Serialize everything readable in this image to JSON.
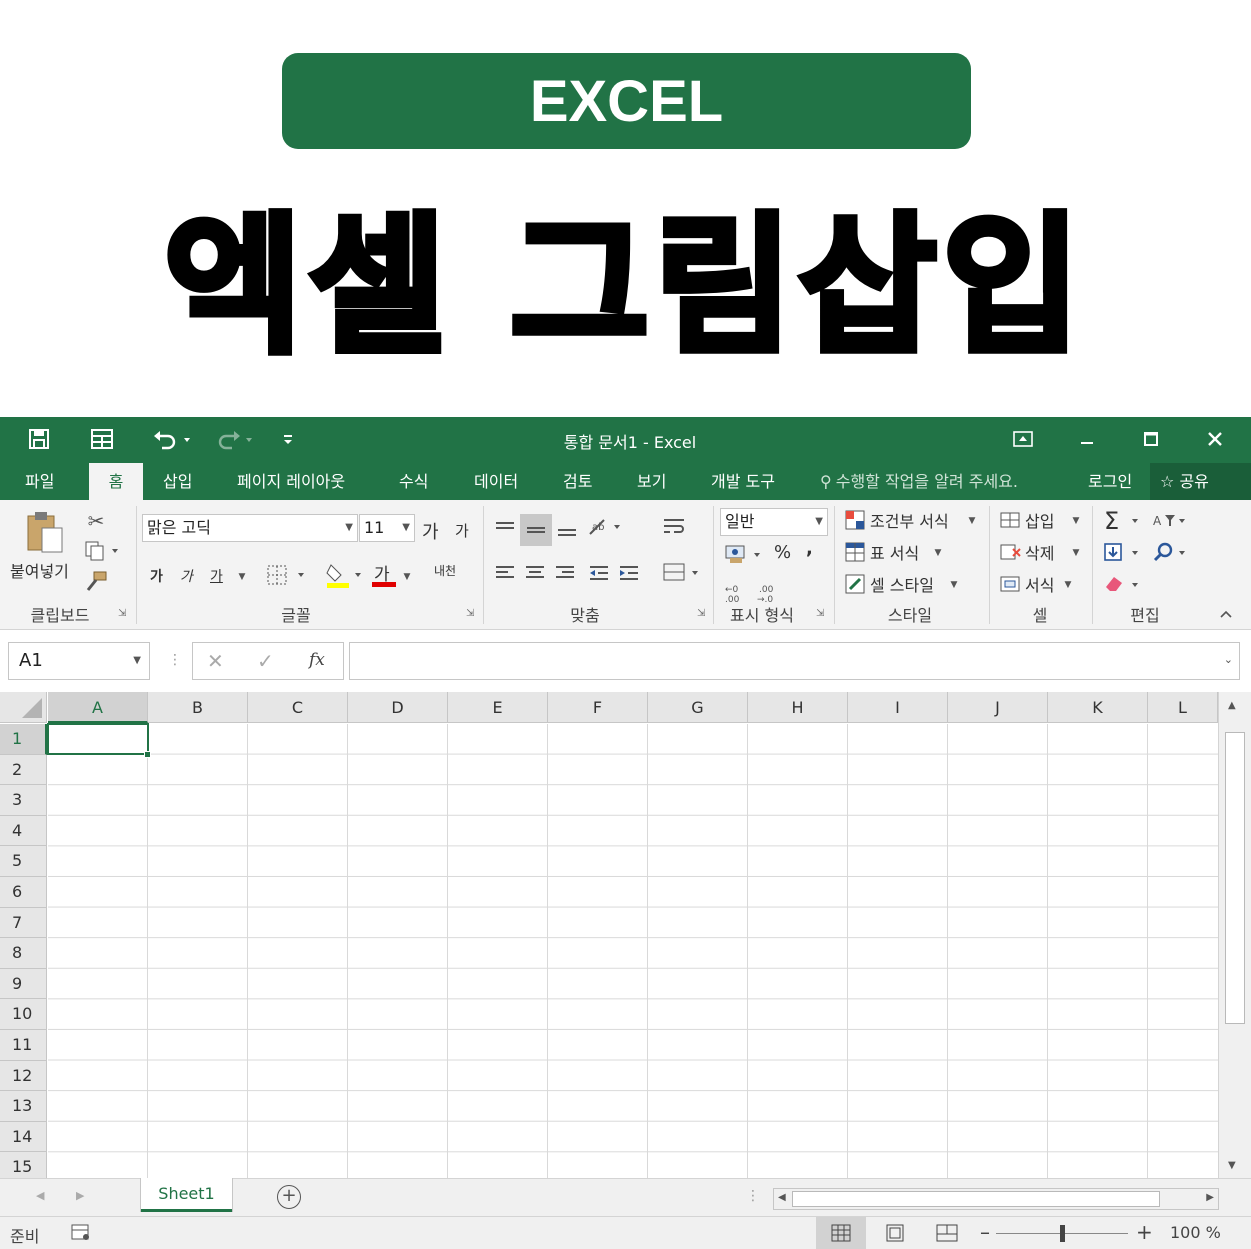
{
  "banner": {
    "badge": "EXCEL",
    "headline": "엑셀 그림삽입"
  },
  "window": {
    "title": "통합 문서1 - Excel",
    "tabs": [
      "파일",
      "홈",
      "삽입",
      "페이지 레이아웃",
      "수식",
      "데이터",
      "검토",
      "보기",
      "개발 도구"
    ],
    "active_tab": "홈",
    "tell_me": "수행할 작업을 알려 주세요.",
    "signin": "로그인",
    "share": "공유"
  },
  "ribbon": {
    "clipboard": {
      "label": "클립보드",
      "paste": "붙여넣기"
    },
    "font": {
      "label": "글꼴",
      "font_name": "맑은 고딕",
      "font_size": "11",
      "grow": "가",
      "shrink": "가",
      "bold": "가",
      "italic": "가",
      "underline": "가",
      "font_color_glyph": "가",
      "phonetic": "내천"
    },
    "alignment": {
      "label": "맞춤"
    },
    "number": {
      "label": "표시 형식",
      "format": "일반",
      "percent": "%",
      "comma": ","
    },
    "styles": {
      "label": "스타일",
      "conditional": "조건부 서식",
      "table": "표 서식",
      "cell_style": "셀 스타일"
    },
    "cells": {
      "label": "셀",
      "insert": "삽입",
      "delete": "삭제",
      "format": "서식"
    },
    "editing": {
      "label": "편집"
    }
  },
  "formula_bar": {
    "name_box": "A1",
    "fx": "fx",
    "value": ""
  },
  "grid": {
    "columns": [
      "A",
      "B",
      "C",
      "D",
      "E",
      "F",
      "G",
      "H",
      "I",
      "J",
      "K",
      "L"
    ],
    "rows": [
      "1",
      "2",
      "3",
      "4",
      "5",
      "6",
      "7",
      "8",
      "9",
      "10",
      "11",
      "12",
      "13",
      "14",
      "15"
    ],
    "active_cell": "A1"
  },
  "sheets": [
    "Sheet1"
  ],
  "status": {
    "ready": "준비",
    "zoom": "100 %"
  },
  "colors": {
    "accent": "#217346"
  }
}
